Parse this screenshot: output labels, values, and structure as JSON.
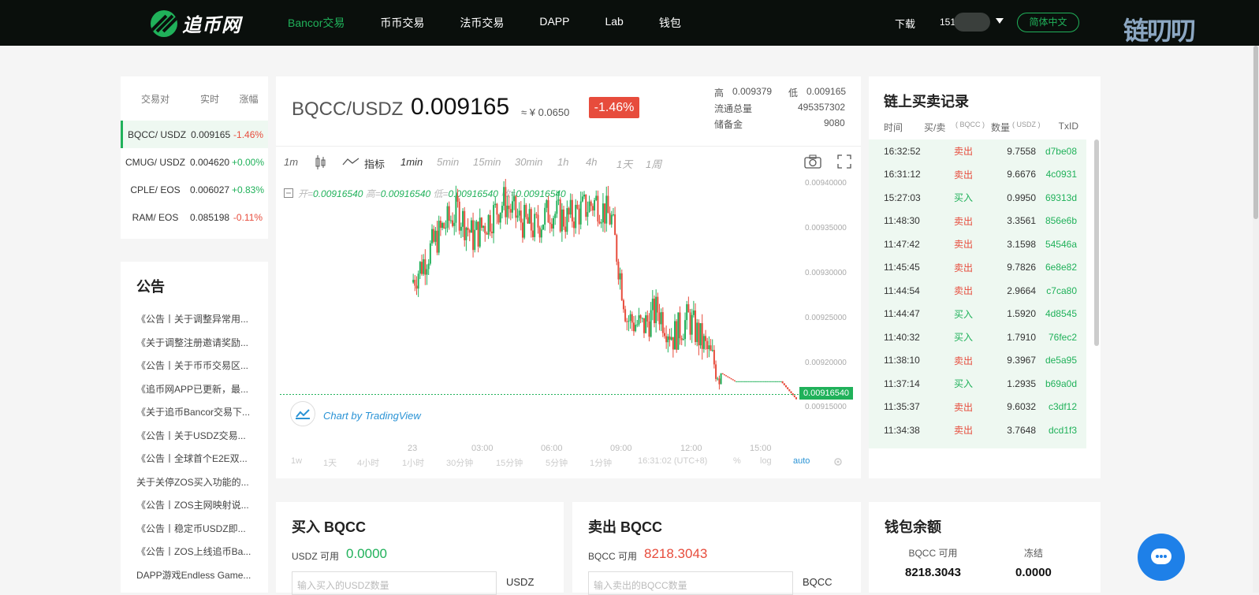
{
  "header": {
    "logo_text": "追币网",
    "nav": [
      {
        "label": "Bancor交易",
        "active": true
      },
      {
        "label": "币币交易"
      },
      {
        "label": "法币交易"
      },
      {
        "label": "DAPP"
      },
      {
        "label": "Lab"
      },
      {
        "label": "钱包"
      }
    ],
    "download": "下载",
    "user_prefix": "151",
    "lang": "简体中文",
    "watermark": "链叨叨"
  },
  "pairs": {
    "headers": [
      "交易对",
      "实时",
      "涨幅"
    ],
    "rows": [
      {
        "pair": "BQCC/ USDZ",
        "price": "0.009165",
        "change": "-1.46%",
        "dir": "neg",
        "active": true
      },
      {
        "pair": "CMUG/ USDZ",
        "price": "0.004620",
        "change": "+0.00%",
        "dir": "pos"
      },
      {
        "pair": "CPLE/ EOS",
        "price": "0.006027",
        "change": "+0.83%",
        "dir": "pos"
      },
      {
        "pair": "RAM/ EOS",
        "price": "0.085198",
        "change": "-0.11%",
        "dir": "neg"
      }
    ]
  },
  "notice": {
    "title": "公告",
    "items": [
      "《公告丨关于调整异常用...",
      "《关于调整注册邀请奖励...",
      "《公告丨关于币币交易区...",
      "《追币网APP已更新，最...",
      "《关于追币Bancor交易下...",
      "《公告丨关于USDZ交易...",
      "《公告丨全球首个E2E双...",
      "关于关停ZOS买入功能的...",
      "《公告丨ZOS主网映射说...",
      "《公告丨稳定币USDZ即...",
      "《公告丨ZOS上线追币Ba...",
      "DAPP游戏Endless Game..."
    ]
  },
  "ticker": {
    "pair": "BQCC/USDZ",
    "price": "0.009165",
    "cny": "≈ ¥  0.0650",
    "change": "-1.46%",
    "high_label": "高",
    "high": "0.009379",
    "low_label": "低",
    "low": "0.009165",
    "supply_label": "流通总量",
    "supply": "495357302",
    "reserve_label": "储备金",
    "reserve": "9080"
  },
  "chart_toolbar": {
    "interval": "1m",
    "indicator": "指标",
    "periods": [
      "1min",
      "5min",
      "15min",
      "30min",
      "1h",
      "4h",
      "1天",
      "1周"
    ]
  },
  "chart_data": {
    "type": "candlestick",
    "ohlc": {
      "open_label": "开=",
      "open": "0.00916540",
      "high_label": "高=",
      "high": "0.00916540",
      "low_label": "低=",
      "low": "0.00916540",
      "close_label": "收=",
      "close": "0.00916540"
    },
    "y_ticks": [
      "0.00940000",
      "0.00935000",
      "0.00930000",
      "0.00925000",
      "0.00920000",
      "0.00915000"
    ],
    "ylim": [
      0.00915,
      0.0094
    ],
    "x_ticks": [
      "23",
      "03:00",
      "06:00",
      "09:00",
      "12:00",
      "15:00"
    ],
    "last_price": "0.00916540",
    "close_series": [
      0.00929,
      0.00932,
      0.00935,
      0.00937,
      0.00934,
      0.00936,
      0.00938,
      0.00936,
      0.00935,
      0.00937,
      0.00936,
      0.00937,
      0.00938,
      0.00936,
      0.00925,
      0.00924,
      0.00926,
      0.00923,
      0.00925,
      0.00922,
      0.00919,
      0.00918,
      0.00918,
      0.00918,
      0.00918,
      0.00916
    ],
    "watermark": "Chart by TradingView"
  },
  "chart_bottom": {
    "ranges": [
      "1w",
      "1天",
      "4小时",
      "1小时",
      "30分钟",
      "15分钟",
      "5分钟",
      "1分钟"
    ],
    "time": "16:31:02 (UTC+8)",
    "pct": "%",
    "log": "log",
    "auto": "auto"
  },
  "trades": {
    "title": "链上买卖记录",
    "headers": {
      "time": "时间",
      "side": "买/卖",
      "side_unit": "( BQCC )",
      "amount": "数量",
      "amount_unit": "( USDZ )",
      "txid": "TxID"
    },
    "rows": [
      {
        "time": "16:32:52",
        "side": "卖出",
        "amount": "9.7558",
        "txid": "d7be08"
      },
      {
        "time": "16:31:12",
        "side": "卖出",
        "amount": "9.6676",
        "txid": "4c0931"
      },
      {
        "time": "15:27:03",
        "side": "买入",
        "amount": "0.9950",
        "txid": "69313d"
      },
      {
        "time": "11:48:30",
        "side": "卖出",
        "amount": "3.3561",
        "txid": "856e6b"
      },
      {
        "time": "11:47:42",
        "side": "卖出",
        "amount": "3.1598",
        "txid": "54546a"
      },
      {
        "time": "11:45:45",
        "side": "卖出",
        "amount": "9.7826",
        "txid": "6e8e82"
      },
      {
        "time": "11:44:54",
        "side": "卖出",
        "amount": "2.9664",
        "txid": "c7ca80"
      },
      {
        "time": "11:44:47",
        "side": "买入",
        "amount": "1.5920",
        "txid": "4d8545"
      },
      {
        "time": "11:40:32",
        "side": "买入",
        "amount": "1.7910",
        "txid": "76fec2"
      },
      {
        "time": "11:38:10",
        "side": "卖出",
        "amount": "9.3967",
        "txid": "de5a95"
      },
      {
        "time": "11:37:14",
        "side": "买入",
        "amount": "1.2935",
        "txid": "b69a0d"
      },
      {
        "time": "11:35:37",
        "side": "卖出",
        "amount": "9.6032",
        "txid": "c3df12"
      },
      {
        "time": "11:34:38",
        "side": "卖出",
        "amount": "3.7648",
        "txid": "dcd1f3"
      }
    ]
  },
  "buy": {
    "title": "买入 BQCC",
    "avail_label": "USDZ 可用",
    "avail": "0.0000",
    "placeholder": "输入买入的USDZ数量",
    "unit": "USDZ"
  },
  "sell": {
    "title": "卖出 BQCC",
    "avail_label": "BQCC 可用",
    "avail": "8218.3043",
    "placeholder": "输入卖出的BQCC数量",
    "unit": "BQCC"
  },
  "wallet": {
    "title": "钱包余额",
    "avail_label": "BQCC 可用",
    "avail": "8218.3043",
    "frozen_label": "冻结",
    "frozen": "0.0000"
  },
  "colors": {
    "up": "#20b15a",
    "down": "#e74c3c",
    "accent": "#20b15a"
  }
}
